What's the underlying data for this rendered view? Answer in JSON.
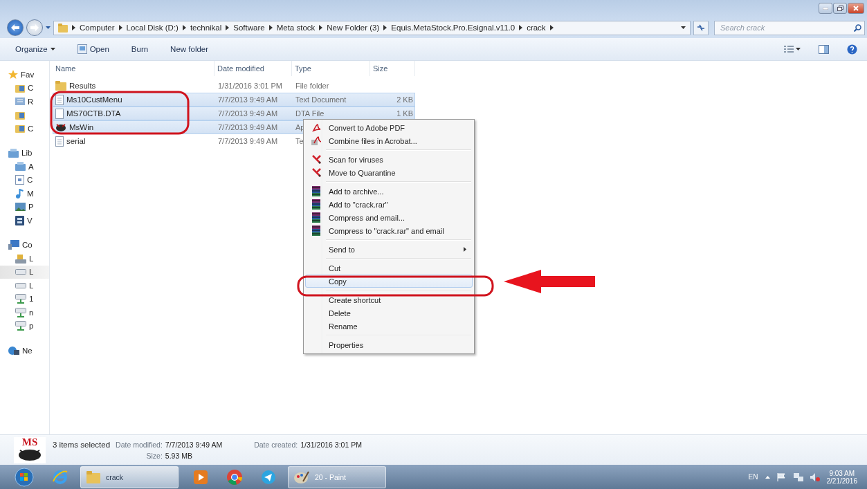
{
  "address": {
    "crumbs": [
      "Computer",
      "Local Disk (D:)",
      "technikal",
      "Software",
      "Meta stock",
      "New Folder (3)",
      "Equis.MetaStock.Pro.Esignal.v11.0",
      "crack"
    ]
  },
  "search": {
    "placeholder": "Search crack"
  },
  "toolbar": {
    "buttons": [
      {
        "label": "Organize",
        "kind": "menu"
      },
      {
        "label": "Open",
        "kind": "open"
      },
      {
        "label": "Burn",
        "kind": "plain"
      },
      {
        "label": "New folder",
        "kind": "plain"
      }
    ]
  },
  "sidebar": {
    "groups": [
      {
        "label": "Fav",
        "kind": "star",
        "selected": false,
        "children": [
          {
            "label": "C",
            "kind": "folder",
            "selected": false
          },
          {
            "label": "R",
            "kind": "recent",
            "selected": false
          },
          {
            "kind": "folder",
            "selected": false
          },
          {
            "label": "C",
            "kind": "folder",
            "selected": false
          }
        ]
      },
      {
        "label": "Lib",
        "kind": "library",
        "selected": false,
        "children": [
          {
            "label": "A",
            "kind": "library",
            "selected": false
          },
          {
            "label": "C",
            "kind": "document",
            "selected": false
          },
          {
            "label": "M",
            "kind": "music",
            "selected": false
          },
          {
            "label": "P",
            "kind": "picture",
            "selected": false
          },
          {
            "label": "V",
            "kind": "video",
            "selected": false
          }
        ]
      },
      {
        "label": "Co",
        "kind": "computer",
        "selected": false,
        "children": [
          {
            "label": "L",
            "kind": "system-drive",
            "selected": false
          },
          {
            "label": "L",
            "kind": "drive",
            "selected": true
          },
          {
            "label": "L",
            "kind": "drive",
            "selected": false
          },
          {
            "label": "1",
            "kind": "network-drive",
            "selected": false
          },
          {
            "label": "n",
            "kind": "network-drive",
            "selected": false
          },
          {
            "label": "p",
            "kind": "network-drive",
            "selected": false
          }
        ]
      },
      {
        "label": "Ne",
        "kind": "network",
        "selected": false
      }
    ]
  },
  "table": {
    "columns": [
      "Name",
      "Date modified",
      "Type",
      "Size"
    ],
    "rows": [
      {
        "kind": "folder",
        "name": "Results",
        "date": "1/31/2016 3:01 PM",
        "type": "File folder",
        "selected": false
      },
      {
        "kind": "text",
        "name": "Ms10CustMenu",
        "date": "7/7/2013 9:49 AM",
        "type": "Text Document",
        "size": "2 KB",
        "selected": true
      },
      {
        "kind": "file",
        "name": "MS70CTB.DTA",
        "date": "7/7/2013 9:49 AM",
        "type": "DTA File",
        "size": "1 KB",
        "selected": true
      },
      {
        "kind": "app",
        "name": "MsWin",
        "date": "7/7/2013 9:49 AM",
        "type": "Ap",
        "selected": true
      },
      {
        "kind": "text",
        "name": "serial",
        "date": "7/7/2013 9:49 AM",
        "type": "Te",
        "selected": false
      }
    ]
  },
  "context_menu": {
    "groups": [
      [
        {
          "label": "Convert to Adobe PDF",
          "kind": "pdf",
          "selected": false
        },
        {
          "label": "Combine files in Acrobat...",
          "kind": "acrobat",
          "selected": false
        }
      ],
      [
        {
          "label": "Scan for viruses",
          "kind": "antivirus",
          "selected": false
        },
        {
          "label": "Move to Quarantine",
          "kind": "antivirus",
          "selected": false
        }
      ],
      [
        {
          "label": "Add to archive...",
          "kind": "archive",
          "selected": false
        },
        {
          "label": "Add to \"crack.rar\"",
          "kind": "archive",
          "selected": false
        },
        {
          "label": "Compress and email...",
          "kind": "archive",
          "selected": false
        },
        {
          "label": "Compress to \"crack.rar\" and email",
          "kind": "archive",
          "selected": false
        }
      ],
      [
        {
          "label": "Send to",
          "submenu": true,
          "selected": false
        }
      ],
      [
        {
          "label": "Cut",
          "selected": false
        },
        {
          "label": "Copy",
          "selected": true
        }
      ],
      [
        {
          "label": "Create shortcut",
          "selected": false
        },
        {
          "label": "Delete",
          "selected": false
        },
        {
          "label": "Rename",
          "selected": false
        }
      ],
      [
        {
          "label": "Properties",
          "selected": false
        }
      ]
    ]
  },
  "status_bar": {
    "logo_text": "MS",
    "summary": "3 items selected",
    "modified_label": "Date modified:",
    "modified_value": "7/7/2013 9:49 AM",
    "created_label": "Date created:",
    "created_value": "1/31/2016 3:01 PM",
    "size_label": "Size:",
    "size_value": "5.93 MB"
  },
  "taskbar": {
    "items": [
      {
        "kind": "start"
      },
      {
        "kind": "browser"
      },
      {
        "kind": "folder",
        "label": "crack",
        "selected": true
      },
      {
        "kind": "media"
      },
      {
        "kind": "chrome"
      },
      {
        "kind": "telegram"
      },
      {
        "kind": "paint",
        "label": "20 - Paint",
        "selected": false
      }
    ],
    "language": "EN",
    "time": "9:03 AM",
    "date": "2/21/2016"
  }
}
